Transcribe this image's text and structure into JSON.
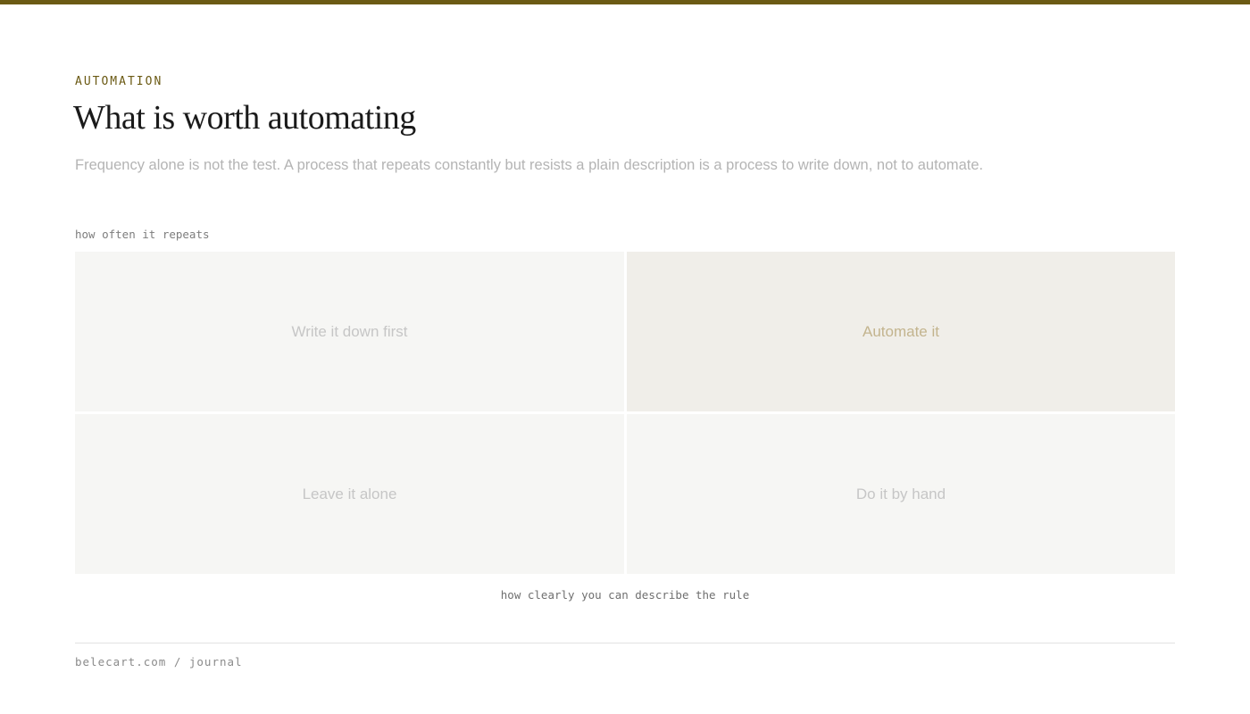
{
  "colors": {
    "accent": "#6b5a14",
    "highlight_cell_bg": "#f0eee9",
    "highlight_cell_text": "#c3b48e",
    "cell_bg": "#f6f6f4",
    "cell_text": "#c6c6c6"
  },
  "header": {
    "eyebrow": "AUTOMATION",
    "title": "What is worth automating",
    "lede": "Frequency alone is not the test. A process that repeats constantly but resists a plain description is a process to write down, not to automate."
  },
  "matrix": {
    "y_axis_label": "how often it repeats",
    "x_axis_label": "how clearly you can describe the rule",
    "quadrants": {
      "top_left": "Write it down first",
      "top_right": "Automate it",
      "bottom_left": "Leave it alone",
      "bottom_right": "Do it by hand"
    },
    "highlighted": "top_right"
  },
  "footer": {
    "text": "belecart.com / journal"
  }
}
